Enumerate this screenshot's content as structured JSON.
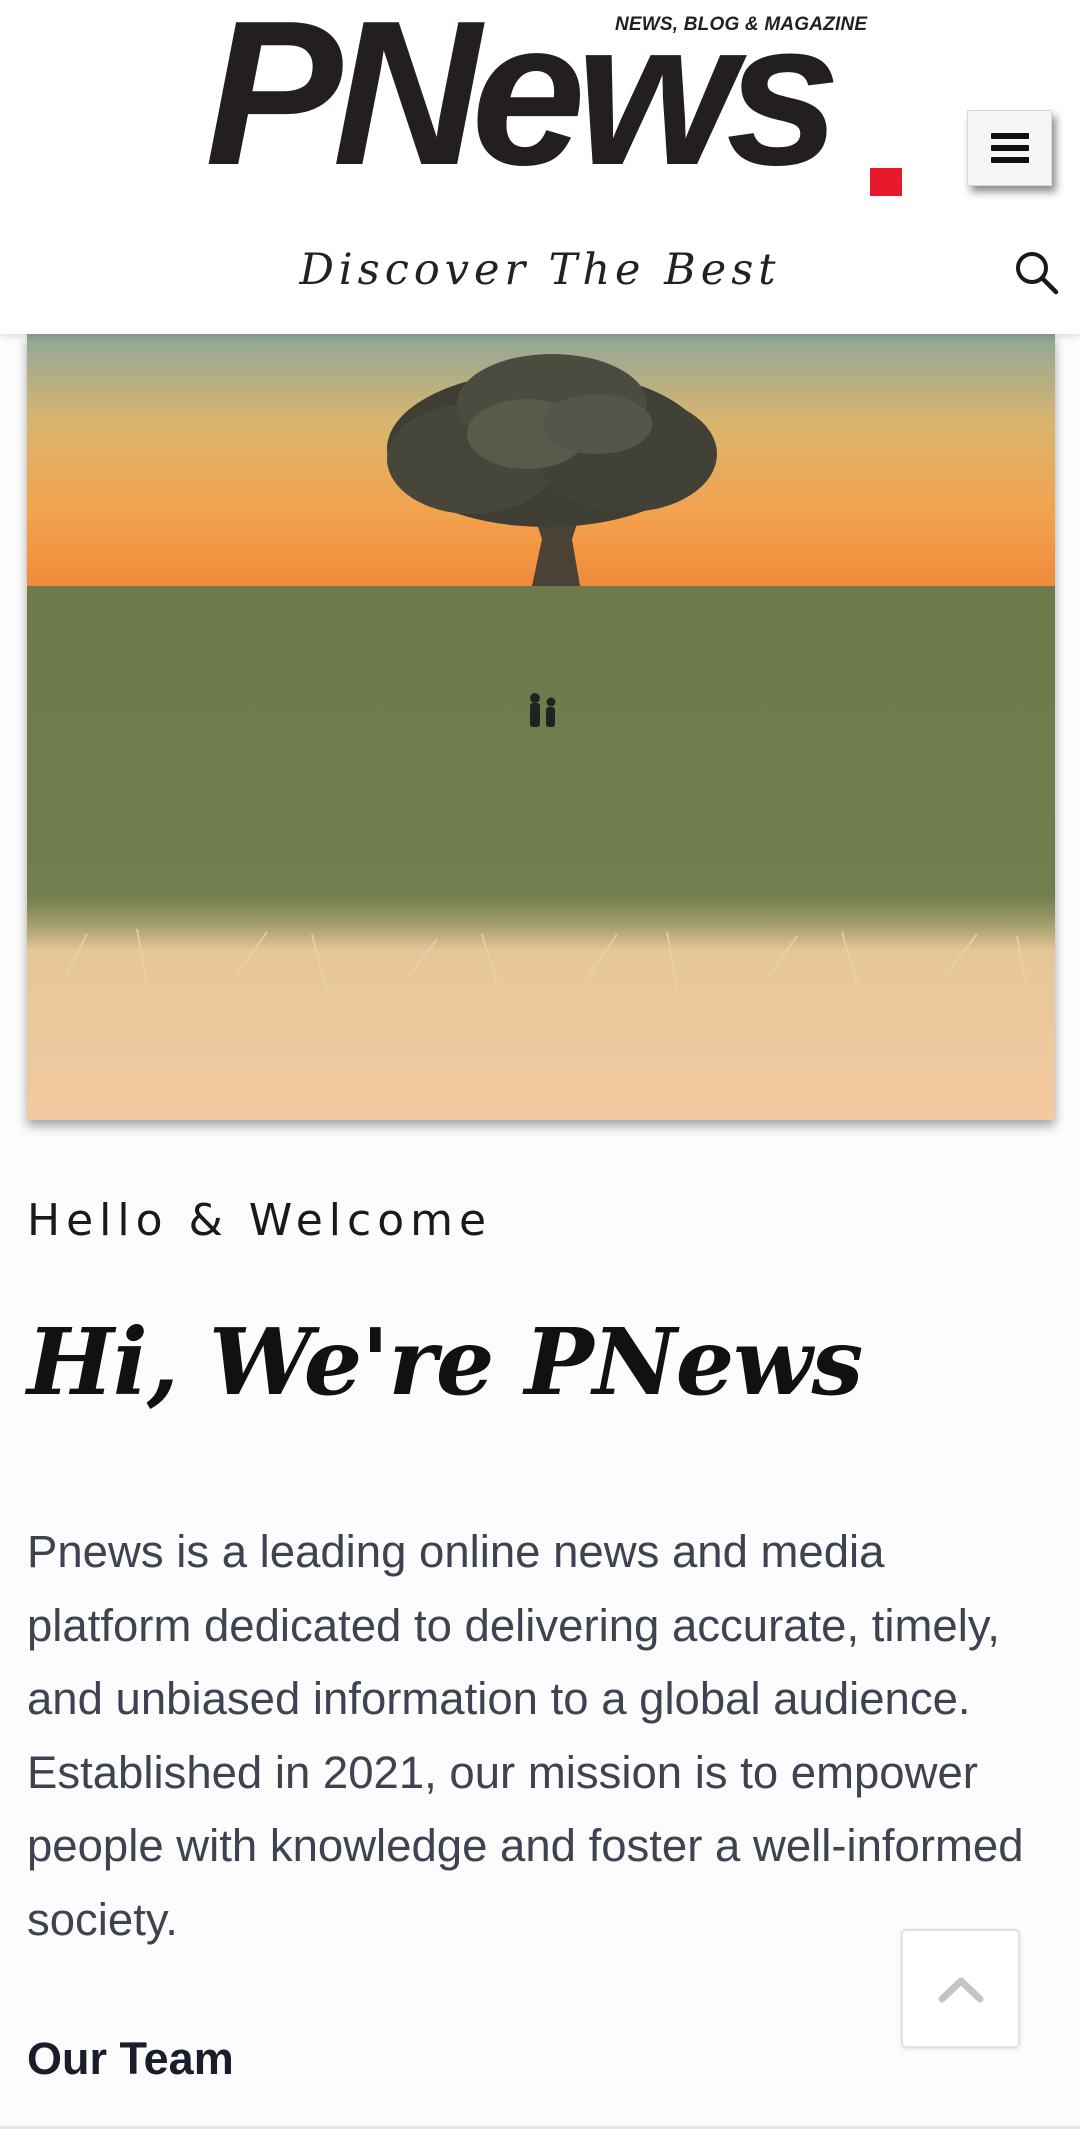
{
  "header": {
    "logo_text": "PNews",
    "logo_tagline": "NEWS, BLOG & MAGAZINE",
    "subtitle": "Discover The Best",
    "menu_icon": "hamburger-icon",
    "search_icon": "search-icon",
    "accent_color": "#e8192c"
  },
  "hero": {
    "image_description_icon": "landscape-tree-image"
  },
  "intro": {
    "eyebrow": "Hello & Welcome",
    "headline": "Hi, We're PNews",
    "body": "Pnews is a leading online news and media platform dedicated to delivering accurate, timely, and unbiased information to a global audience. Established in 2021, our mission is to empower people with knowledge and foster a well-informed society.",
    "section_heading": "Our Team"
  },
  "scroll_top": {
    "icon": "chevron-up-icon"
  }
}
